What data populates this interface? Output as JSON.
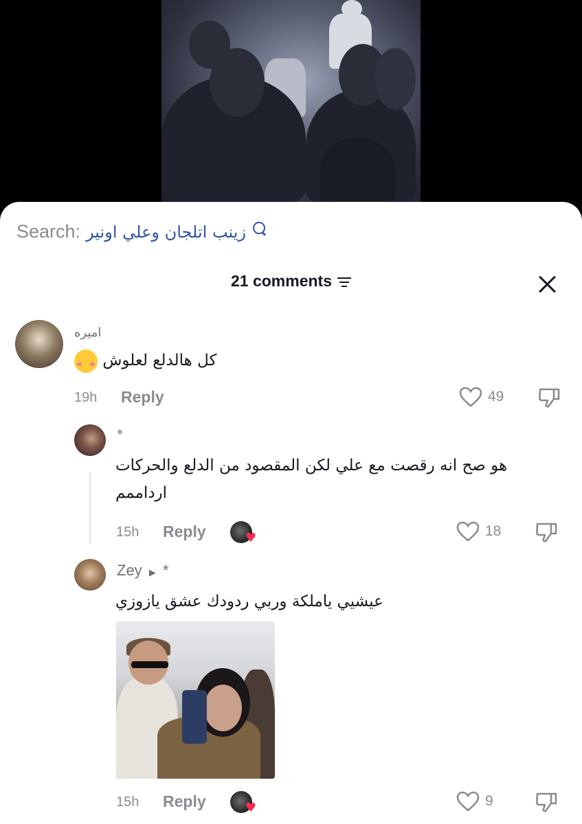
{
  "search": {
    "label": "Search:",
    "query": "زينب اتلجان وعلي اونير"
  },
  "header": {
    "comments_count": "21 comments"
  },
  "comments": [
    {
      "username": "اميره",
      "text": "كل هالدلع لعلوش",
      "emoji": "smiling-face-with-hearts",
      "time": "19h",
      "reply_label": "Reply",
      "likes": "49"
    },
    {
      "username": "*",
      "text_line1": "هو صح انه رقصت مع علي لكن المقصود من الدلع والحركات",
      "text_line2": "ارداممم",
      "time": "15h",
      "reply_label": "Reply",
      "likes": "18",
      "liked_by_creator": true
    },
    {
      "username": "Zey",
      "reply_to": "*",
      "text": "عيشيي ياملكة وربي ردودك عشق يازوزي",
      "has_image": true,
      "time": "15h",
      "reply_label": "Reply",
      "likes": "9",
      "liked_by_creator": true
    }
  ],
  "colors": {
    "accent_link": "#2f55a4",
    "muted_text": "#8a8b91",
    "heart_red": "#fe2c55"
  }
}
